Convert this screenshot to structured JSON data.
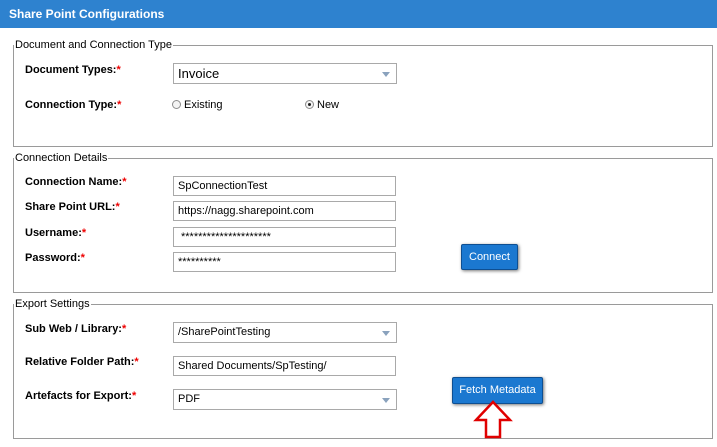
{
  "title": "Share Point Configurations",
  "doc_section": {
    "legend": "Document and Connection Type",
    "document_types_label": "Document Types:",
    "document_types_value": "Invoice",
    "connection_type_label": "Connection Type:",
    "radio_existing": "Existing",
    "radio_new": "New",
    "selected": "New"
  },
  "conn_section": {
    "legend": "Connection Details",
    "connection_name_label": "Connection Name:",
    "connection_name_value": "SpConnectionTest",
    "url_label": "Share Point URL:",
    "url_value": "https://nagg.sharepoint.com",
    "username_label": "Username:",
    "username_value": "*********************",
    "password_label": "Password:",
    "password_value": "**********",
    "connect_button": "Connect"
  },
  "export_section": {
    "legend": "Export Settings",
    "subweb_label": "Sub Web / Library:",
    "subweb_value": "/SharePointTesting",
    "folder_label": "Relative Folder Path:",
    "folder_value": "Shared Documents/SpTesting/",
    "artefacts_label": "Artefacts for Export:",
    "artefacts_value": "PDF",
    "fetch_button": "Fetch Metadata"
  },
  "required_marker": "*",
  "colors": {
    "header": "#2e82cf",
    "button": "#1b78d0",
    "required": "#ee0000",
    "annotation_arrow": "#e00000"
  },
  "annotation_icon": "up-arrow-icon"
}
